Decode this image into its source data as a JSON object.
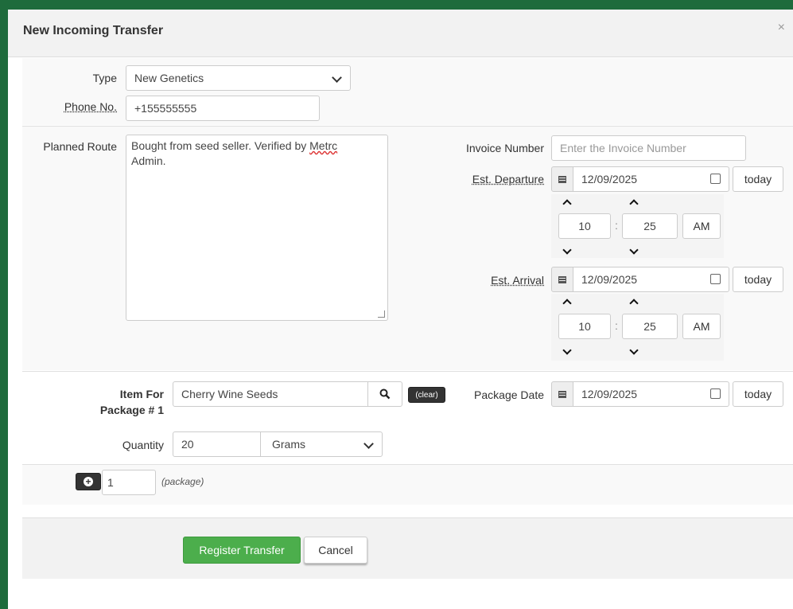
{
  "dialog": {
    "title": "New Incoming Transfer",
    "close_glyph": "×"
  },
  "form": {
    "type_label": "Type",
    "type_value": "New Genetics",
    "phone_label": "Phone No.",
    "phone_value": "+155555555",
    "planned_route_label": "Planned Route",
    "planned_route_value_1": "Bought from seed seller. Verified by ",
    "planned_route_value_misspelled": "Metrc",
    "planned_route_value_2": "Admin.",
    "invoice_label": "Invoice Number",
    "invoice_placeholder": "Enter the Invoice Number",
    "est_departure_label": "Est. Departure",
    "est_departure_date": "12/09/2025",
    "departure_hour": "10",
    "departure_minute": "25",
    "departure_ampm": "AM",
    "est_arrival_label": "Est. Arrival",
    "est_arrival_date": "12/09/2025",
    "arrival_hour": "10",
    "arrival_minute": "25",
    "arrival_ampm": "AM",
    "today_label": "today",
    "time_separator": ":"
  },
  "package": {
    "item_label_1": "Item For",
    "item_label_2": "Package # 1",
    "item_value": "Cherry Wine Seeds",
    "clear_label": "(clear)",
    "package_date_label": "Package Date",
    "package_date_value": "12/09/2025",
    "quantity_label": "Quantity",
    "quantity_value": "20",
    "unit_value": "Grams",
    "add_count_value": "1",
    "add_suffix": "(package)"
  },
  "actions": {
    "register_label": "Register Transfer",
    "cancel_label": "Cancel"
  },
  "colors": {
    "frame": "#1e6b3c",
    "register_button": "#4cae4c",
    "clear_button": "#333333"
  },
  "icons": [
    "calendar-icon",
    "search-icon",
    "plus-circle-icon",
    "chevron-down-icon",
    "chevron-up-icon",
    "close-icon"
  ]
}
